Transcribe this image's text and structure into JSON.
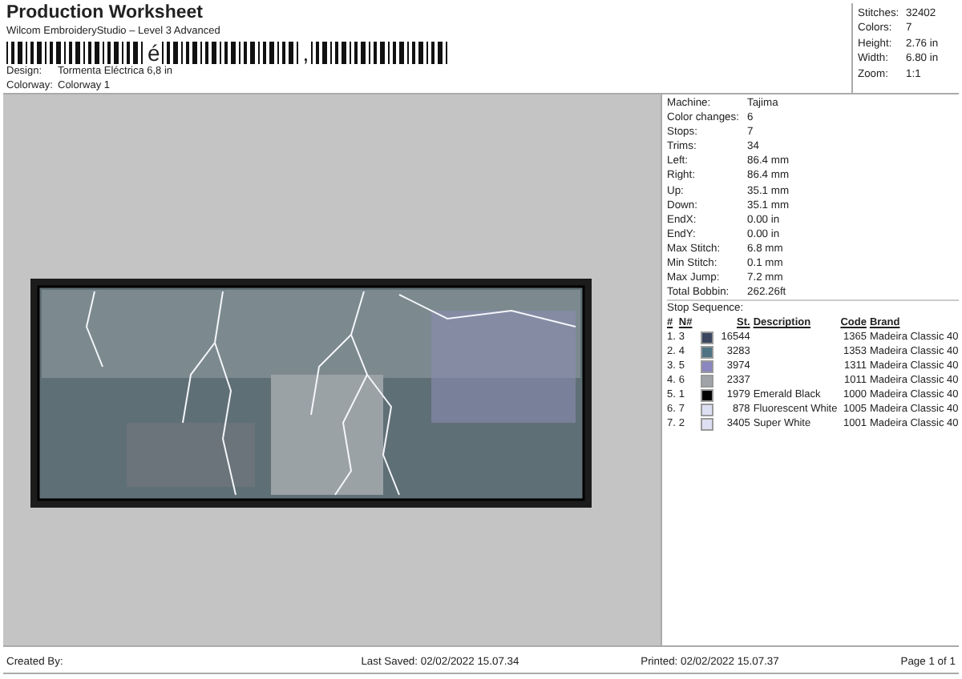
{
  "header": {
    "title": "Production Worksheet",
    "subtitle": "Wilcom EmbroideryStudio – Level 3 Advanced",
    "barcode": [
      {
        "kind": "bars"
      },
      {
        "kind": "char",
        "text": "é"
      },
      {
        "kind": "bars"
      },
      {
        "kind": "char",
        "text": ","
      },
      {
        "kind": "bars"
      }
    ],
    "fields": [
      {
        "label": "Design:",
        "value": "Tormenta Eléctrica 6,8 in"
      },
      {
        "label": "Colorway:",
        "value": "Colorway 1"
      }
    ]
  },
  "summary": [
    {
      "label": "Stitches:",
      "value": "32402"
    },
    {
      "label": "Colors:",
      "value": "7"
    },
    {
      "label": "Height:",
      "value": "2.76 in"
    },
    {
      "label": "Width:",
      "value": "6.80 in"
    },
    {
      "label": "Zoom:",
      "value": "1:1"
    }
  ],
  "details": [
    {
      "label": "Machine:",
      "value": "Tajima"
    },
    {
      "label": "Color changes:",
      "value": "6"
    },
    {
      "label": "Stops:",
      "value": "7"
    },
    {
      "label": "Trims:",
      "value": "34"
    },
    {
      "label": "Left:",
      "value": "86.4 mm"
    },
    {
      "label": "Right:",
      "value": "86.4 mm"
    },
    {
      "label": "Up:",
      "value": "35.1 mm"
    },
    {
      "label": "Down:",
      "value": "35.1 mm"
    },
    {
      "label": "EndX:",
      "value": "0.00 in"
    },
    {
      "label": "EndY:",
      "value": "0.00 in"
    },
    {
      "label": "Max Stitch:",
      "value": "6.8 mm"
    },
    {
      "label": "Min Stitch:",
      "value": "0.1 mm"
    },
    {
      "label": "Max Jump:",
      "value": "7.2 mm"
    },
    {
      "label": "Total Bobbin:",
      "value": "262.26ft"
    }
  ],
  "stop_sequence": {
    "title": "Stop Sequence:",
    "columns": [
      "#",
      "N#",
      "St.",
      "Description",
      "Code",
      "Brand"
    ],
    "rows": [
      {
        "index": "1.",
        "needle": "3",
        "color": "#3a4560",
        "stitches": "16544",
        "description": "",
        "code": "1365",
        "brand": "Madeira Classic 40"
      },
      {
        "index": "2.",
        "needle": "4",
        "color": "#4e7383",
        "stitches": "3283",
        "description": "",
        "code": "1353",
        "brand": "Madeira Classic 40"
      },
      {
        "index": "3.",
        "needle": "5",
        "color": "#8a86c0",
        "stitches": "3974",
        "description": "",
        "code": "1311",
        "brand": "Madeira Classic 40"
      },
      {
        "index": "4.",
        "needle": "6",
        "color": "#a0a4a8",
        "stitches": "2337",
        "description": "",
        "code": "1011",
        "brand": "Madeira Classic 40"
      },
      {
        "index": "5.",
        "needle": "1",
        "color": "#000000",
        "stitches": "1979",
        "description": "Emerald Black",
        "code": "1000",
        "brand": "Madeira Classic 40"
      },
      {
        "index": "6.",
        "needle": "7",
        "color": "#dde0f2",
        "stitches": "878",
        "description": "Fluorescent White",
        "code": "1005",
        "brand": "Madeira Classic 40"
      },
      {
        "index": "7.",
        "needle": "2",
        "color": "#dde0f2",
        "stitches": "3405",
        "description": "Super White",
        "code": "1001",
        "brand": "Madeira Classic 40"
      }
    ]
  },
  "footer": {
    "created_by": "Created By:",
    "last_saved": "Last Saved: 02/02/2022 15.07.34",
    "printed": "Printed: 02/02/2022 15.07.37",
    "page": "Page 1 of 1"
  }
}
